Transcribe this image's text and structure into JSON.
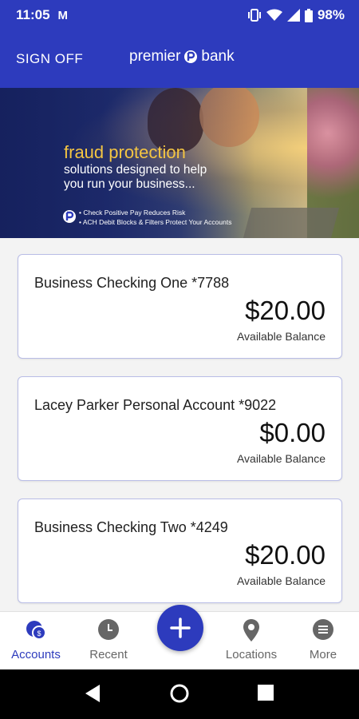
{
  "status_bar": {
    "time": "11:05",
    "app_icon": "M",
    "battery": "98%"
  },
  "header": {
    "signoff": "SIGN OFF",
    "brand_left": "premier",
    "brand_right": "bank"
  },
  "banner": {
    "headline": "fraud protection",
    "sub_line1": "solutions designed to help",
    "sub_line2": "you run your business...",
    "bullet1": "• Check Positive Pay Reduces Risk",
    "bullet2": "• ACH Debit Blocks & Filters Protect Your Accounts"
  },
  "accounts": [
    {
      "name": "Business Checking One *7788",
      "balance": "$20.00",
      "balance_label": "Available Balance"
    },
    {
      "name": "Lacey Parker Personal Account *9022",
      "balance": "$0.00",
      "balance_label": "Available Balance"
    },
    {
      "name": "Business Checking Two *4249",
      "balance": "$20.00",
      "balance_label": "Available Balance"
    }
  ],
  "bottom_nav": {
    "accounts": "Accounts",
    "recent": "Recent",
    "locations": "Locations",
    "more": "More",
    "accounts_badge": "$"
  },
  "colors": {
    "primary": "#2d3bbd",
    "accent_text": "#f4c542"
  }
}
